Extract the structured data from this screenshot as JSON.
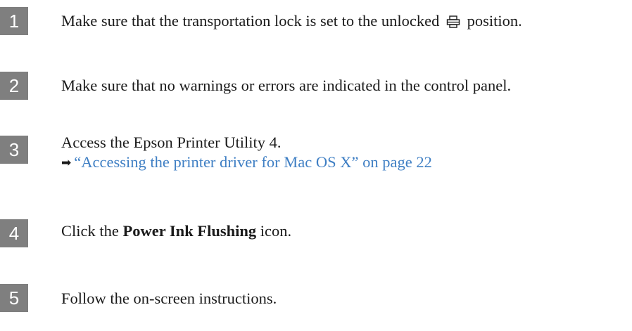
{
  "steps": [
    {
      "number": "1",
      "text_before": "Make sure that the transportation lock is set to the unlocked",
      "icon": "printer-unlocked-icon",
      "text_after": "position."
    },
    {
      "number": "2",
      "text": "Make sure that no warnings or errors are indicated in the control panel."
    },
    {
      "number": "3",
      "text": "Access the Epson Printer Utility 4.",
      "arrow": "➡",
      "link_text": "“Accessing the printer driver for Mac OS X” on page 22"
    },
    {
      "number": "4",
      "text_before": "Click the",
      "bold": "Power Ink Flushing",
      "text_after": "icon."
    },
    {
      "number": "5",
      "text": "Follow the on-screen instructions."
    }
  ],
  "colors": {
    "step_badge": "#7f7f7f",
    "link": "#3f7fc4",
    "text": "#1a1a1a"
  }
}
